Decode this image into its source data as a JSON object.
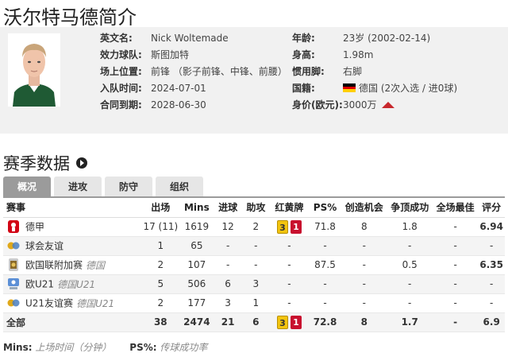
{
  "page_title": "沃尔特马德简介",
  "profile": {
    "left": [
      {
        "label": "英文名:",
        "value": "Nick Woltemade"
      },
      {
        "label": "效力球队:",
        "value": "斯图加特"
      },
      {
        "label": "场上位置:",
        "value": "前锋 （影子前锋、中锋、前腰）"
      },
      {
        "label": "入队时间:",
        "value": "2024-07-01"
      },
      {
        "label": "合同到期:",
        "value": "2028-06-30"
      }
    ],
    "right": {
      "age_label": "年龄:",
      "age_value": "23岁  (2002-02-14)",
      "height_label": "身高:",
      "height_value": "1.98m",
      "foot_label": "惯用脚:",
      "foot_value": "右脚",
      "nation_label": "国籍:",
      "nation_value": "德国 (2次入选 / 进0球)",
      "value_label": "身价(欧元):",
      "value_value": "3000万"
    },
    "flag_colors": [
      "#000000",
      "#dd0000",
      "#ffce00"
    ],
    "arrow_color": "#c8282d"
  },
  "section_title": "赛季数据",
  "tabs": [
    "概况",
    "进攻",
    "防守",
    "组织"
  ],
  "active_tab": 0,
  "table": {
    "headers": {
      "comp": "赛事",
      "apps": "出场",
      "mins": "Mins",
      "goals": "进球",
      "assists": "助攻",
      "cards": "红黄牌",
      "ps": "PS%",
      "chances": "创造机会",
      "aerials": "争顶成功",
      "motm": "全场最佳",
      "rating": "评分"
    },
    "rows": [
      {
        "icon": "bundesliga-icon",
        "name": "德甲",
        "sub": "",
        "apps": "17 (11)",
        "mins": "1619",
        "goals": "12",
        "assists": "2",
        "yellow": "3",
        "red": "1",
        "ps": "71.8",
        "chances": "8",
        "aerials": "1.8",
        "motm": "-",
        "rating": "6.94"
      },
      {
        "icon": "friendly-icon",
        "name": "球会友谊",
        "sub": "",
        "apps": "1",
        "mins": "65",
        "goals": "-",
        "assists": "-",
        "yellow": "",
        "red": "",
        "cards_dash": "-",
        "ps": "-",
        "chances": "-",
        "aerials": "-",
        "motm": "-",
        "rating": "-"
      },
      {
        "icon": "nations-league-icon",
        "name": "欧国联附加赛",
        "sub": "德国",
        "apps": "2",
        "mins": "107",
        "goals": "-",
        "assists": "-",
        "yellow": "",
        "red": "",
        "cards_dash": "-",
        "ps": "87.5",
        "chances": "-",
        "aerials": "0.5",
        "motm": "-",
        "rating": "6.35"
      },
      {
        "icon": "u21-icon",
        "name": "欧U21",
        "sub": "德国U21",
        "apps": "5",
        "mins": "506",
        "goals": "6",
        "assists": "3",
        "yellow": "",
        "red": "",
        "cards_dash": "-",
        "ps": "-",
        "chances": "-",
        "aerials": "-",
        "motm": "-",
        "rating": "-"
      },
      {
        "icon": "friendly-icon",
        "name": "U21友谊赛",
        "sub": "德国U21",
        "apps": "2",
        "mins": "177",
        "goals": "3",
        "assists": "1",
        "yellow": "",
        "red": "",
        "cards_dash": "-",
        "ps": "-",
        "chances": "-",
        "aerials": "-",
        "motm": "-",
        "rating": "-"
      }
    ],
    "total": {
      "name": "全部",
      "apps": "38",
      "mins": "2474",
      "goals": "21",
      "assists": "6",
      "yellow": "3",
      "red": "1",
      "ps": "72.8",
      "chances": "8",
      "aerials": "1.7",
      "motm": "-",
      "rating": "6.9"
    }
  },
  "legend": {
    "mins_key": "Mins:",
    "mins_desc": "上场时间（分钟）",
    "ps_key": "PS%:",
    "ps_desc": "传球成功率"
  }
}
